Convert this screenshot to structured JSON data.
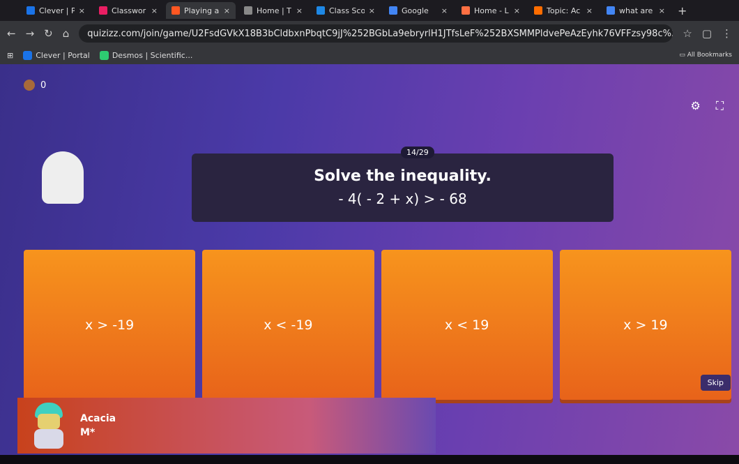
{
  "browser": {
    "tabs": [
      {
        "label": "Clever | P",
        "color": "#1a73e8",
        "active": false
      },
      {
        "label": "Classwor",
        "color": "#e91e63",
        "active": false
      },
      {
        "label": "Playing a",
        "color": "#ff5722",
        "active": true
      },
      {
        "label": "Home | T",
        "color": "#888888",
        "active": false
      },
      {
        "label": "Class Sco",
        "color": "#1e88e5",
        "active": false
      },
      {
        "label": "Google",
        "color": "#4285f4",
        "active": false
      },
      {
        "label": "Home - L",
        "color": "#ff7043",
        "active": false
      },
      {
        "label": "Topic: Ac",
        "color": "#ff6d00",
        "active": false
      },
      {
        "label": "what are",
        "color": "#4285f4",
        "active": false
      }
    ],
    "url": "quizizz.com/join/game/U2FsdGVkX18B3bCldbxnPbqtC9jJ%252BGbLa9ebryrlH1JTfsLeF%252BXSMMPldvePeAzEyhk76VFFzsy98c%252F1gKlWnw%253D%253D?...",
    "bookmarks": [
      {
        "label": "Clever | Portal",
        "color": "#1a73e8"
      },
      {
        "label": "Desmos | Scientific...",
        "color": "#2ecc71"
      }
    ],
    "all_bookmarks": "All Bookmarks"
  },
  "game": {
    "score": "0",
    "counter": "14/29",
    "question_title": "Solve the inequality.",
    "question_expr": "- 4( - 2 + x) > - 68",
    "options": [
      "x > -19",
      "x < -19",
      "x < 19",
      "x > 19"
    ],
    "skip": "Skip",
    "player": {
      "first": "Acacia",
      "last": "M*"
    }
  }
}
